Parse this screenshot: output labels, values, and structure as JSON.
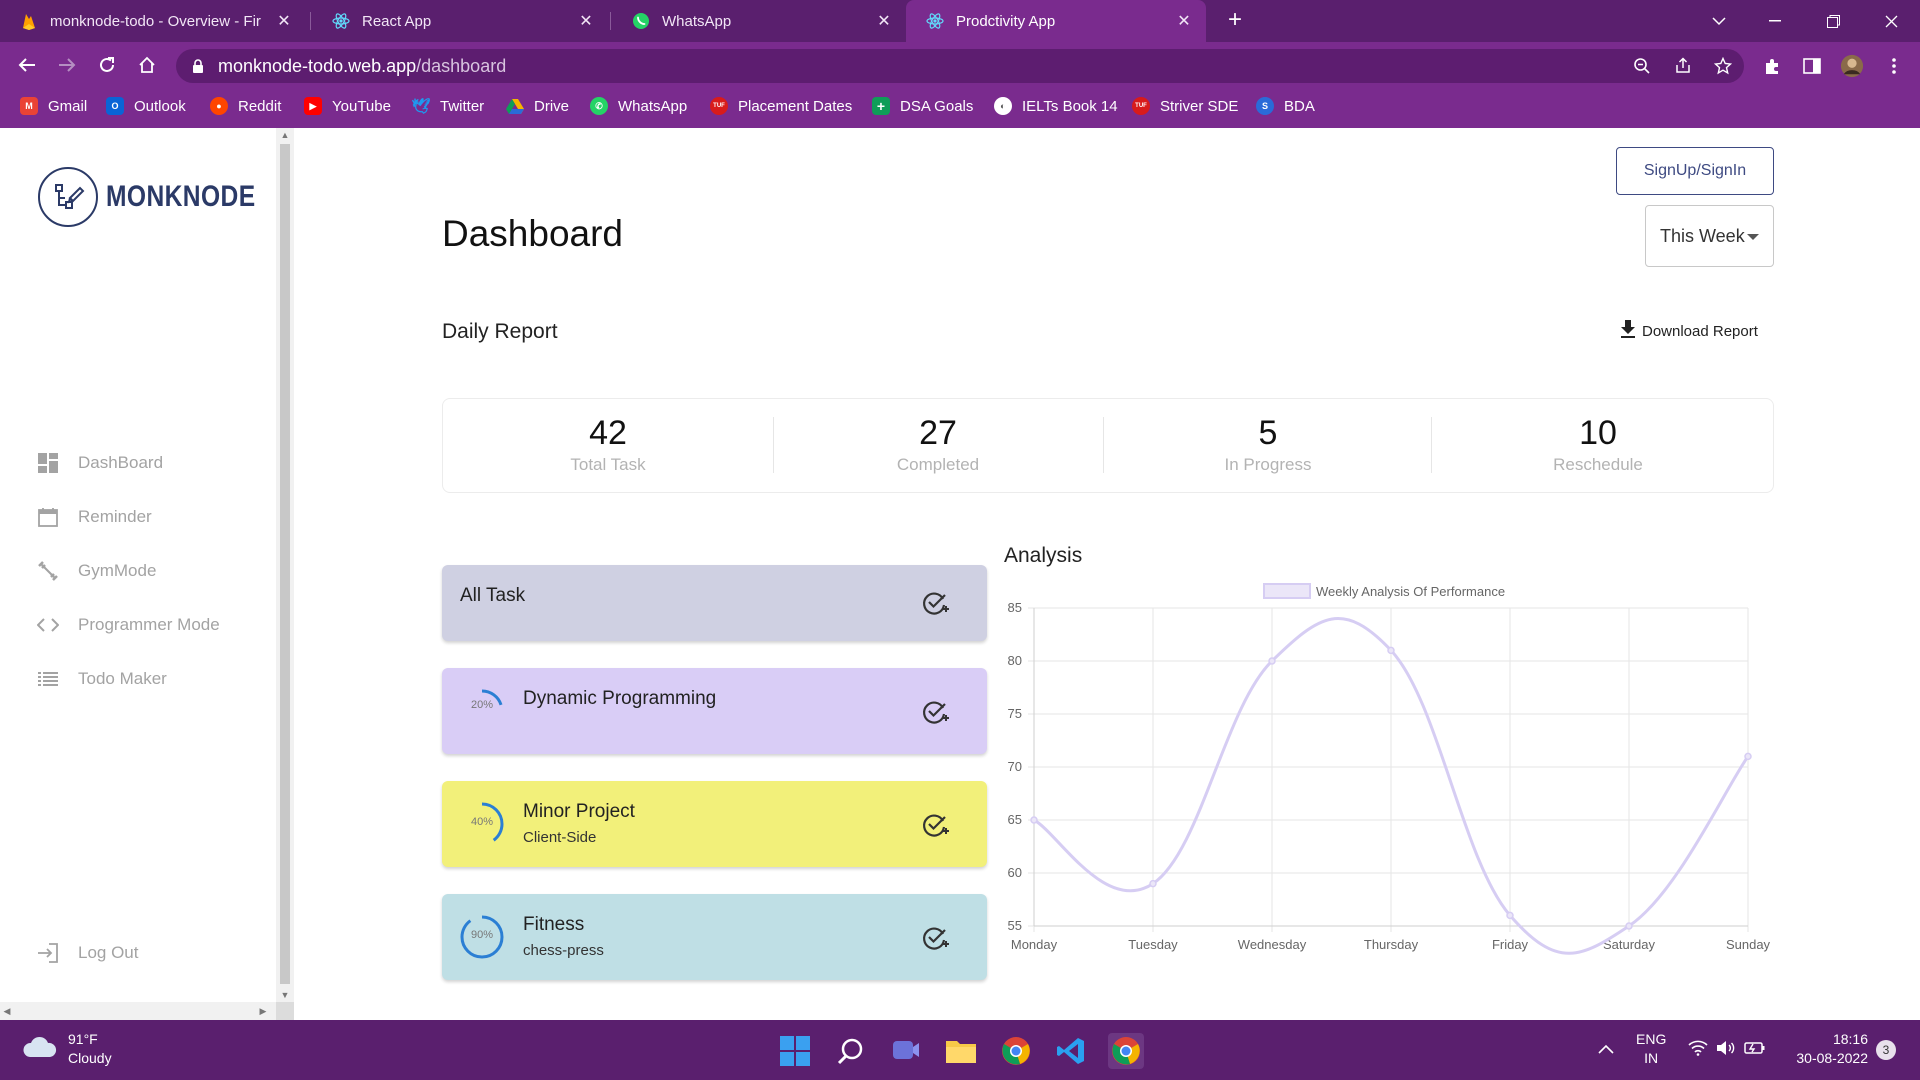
{
  "browser": {
    "tabs": [
      {
        "title": "monknode-todo - Overview - Fir",
        "icon": "firebase-icon"
      },
      {
        "title": "React App",
        "icon": "react-icon"
      },
      {
        "title": "WhatsApp",
        "icon": "whatsapp-icon"
      },
      {
        "title": "Prodctivity App",
        "icon": "react-icon"
      }
    ],
    "url_domain": "monknode-todo.web.app",
    "url_path": "/dashboard",
    "bookmarks": [
      {
        "label": "Gmail",
        "color": "#ea4335"
      },
      {
        "label": "Outlook",
        "color": "#0a64d6"
      },
      {
        "label": "Reddit",
        "color": "#ff4500"
      },
      {
        "label": "YouTube",
        "color": "#ff0000"
      },
      {
        "label": "Twitter",
        "color": "#1d9bf0"
      },
      {
        "label": "Drive",
        "color": "#f6b400"
      },
      {
        "label": "WhatsApp",
        "color": "#25d366"
      },
      {
        "label": "Placement Dates",
        "color": "#d81b1b"
      },
      {
        "label": "DSA Goals",
        "color": "#0f9d58"
      },
      {
        "label": "IELTs Book 14",
        "color": "#555555"
      },
      {
        "label": "Striver SDE",
        "color": "#d81b1b"
      },
      {
        "label": "BDA",
        "color": "#2a6bd8"
      }
    ]
  },
  "sidebar": {
    "logo_text": "MONKNODE",
    "items": [
      {
        "label": "DashBoard",
        "icon": "dashboard-icon"
      },
      {
        "label": "Reminder",
        "icon": "calendar-icon"
      },
      {
        "label": "GymMode",
        "icon": "dumbbell-icon"
      },
      {
        "label": "Programmer Mode",
        "icon": "code-icon"
      },
      {
        "label": "Todo Maker",
        "icon": "list-icon"
      }
    ],
    "logout_label": "Log Out"
  },
  "header": {
    "signin_label": "SignUp/SignIn",
    "period_select": "This Week",
    "title": "Dashboard"
  },
  "daily_report": {
    "title": "Daily Report",
    "download_label": "Download Report",
    "stats": [
      {
        "value": "42",
        "label": "Total Task"
      },
      {
        "value": "27",
        "label": "Completed"
      },
      {
        "value": "5",
        "label": "In Progress"
      },
      {
        "value": "10",
        "label": "Reschedule"
      }
    ]
  },
  "tasks": {
    "all_label": "All Task",
    "items": [
      {
        "title": "Dynamic Programming",
        "subtitle": "",
        "progress_label": "20%",
        "progress": 0.2,
        "color": "#d9cdf6"
      },
      {
        "title": "Minor Project",
        "subtitle": "Client-Side",
        "progress_label": "40%",
        "progress": 0.4,
        "color": "#f2f07a"
      },
      {
        "title": "Fitness",
        "subtitle": "chess-press",
        "progress_label": "90%",
        "progress": 0.9,
        "color": "#bfdfe5"
      }
    ]
  },
  "analysis": {
    "title": "Analysis"
  },
  "chart_data": {
    "type": "line",
    "title": "",
    "legend": "top",
    "categories": [
      "Monday",
      "Tuesday",
      "Wednesday",
      "Thursday",
      "Friday",
      "Saturday",
      "Sunday"
    ],
    "series": [
      {
        "name": "Weekly Analysis Of Performance",
        "values": [
          65,
          59,
          80,
          81,
          56,
          55,
          71
        ],
        "color": "#d6cdf3"
      }
    ],
    "ylim": [
      55,
      85
    ],
    "yticks": [
      "85",
      "80",
      "75",
      "70",
      "65",
      "60",
      "55"
    ],
    "grid": true
  },
  "taskbar": {
    "weather_temp": "91°F",
    "weather_desc": "Cloudy",
    "lang_top": "ENG",
    "lang_bottom": "IN",
    "time": "18:16",
    "date": "30-08-2022",
    "notifications": "3"
  }
}
